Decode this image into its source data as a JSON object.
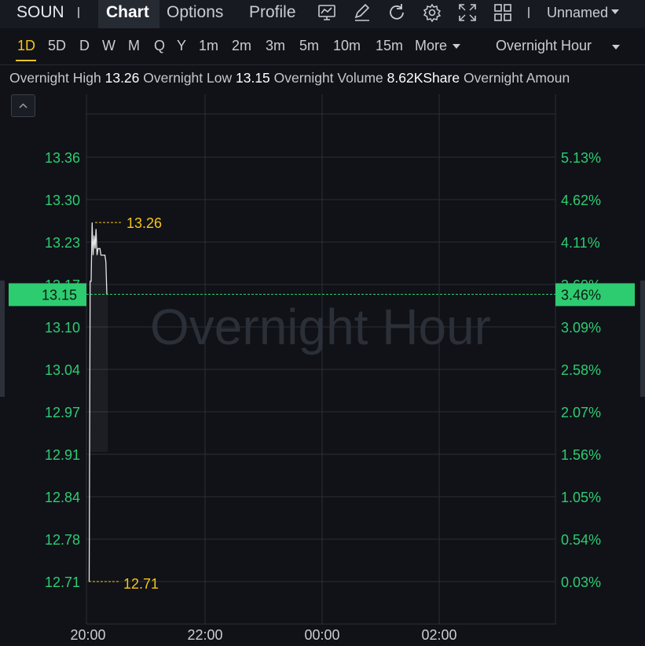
{
  "header": {
    "ticker": "SOUN",
    "tabs": [
      {
        "label": "Chart",
        "active": true
      },
      {
        "label": "Options",
        "active": false
      },
      {
        "label": "Profile",
        "active": false
      }
    ],
    "tool_icons": [
      "chart-settings-icon",
      "draw-icon",
      "refresh-icon",
      "gear-icon",
      "fullscreen-icon",
      "layout-grid-icon"
    ],
    "layout_name": "Unnamed"
  },
  "intervals": {
    "items": [
      "1D",
      "5D",
      "D",
      "W",
      "M",
      "Q",
      "Y",
      "1m",
      "2m",
      "3m",
      "5m",
      "10m",
      "15m"
    ],
    "active": "1D",
    "more_label": "More",
    "session_label": "Overnight Hour"
  },
  "info": {
    "high_label": "Overnight High",
    "high_value": "13.26",
    "low_label": "Overnight Low",
    "low_value": "13.15",
    "volume_label": "Overnight Volume",
    "volume_value": "8.62KShare",
    "amount_label": "Overnight Amoun"
  },
  "colors": {
    "price_axis": "#2ecc71",
    "marker": "#f5c518",
    "current_price_bg": "#2ecc71",
    "line": "#e6e6e6"
  },
  "chart_data": {
    "type": "line",
    "watermark": "Overnight Hour",
    "x_ticks": [
      "20:00",
      "22:00",
      "00:00",
      "02:00"
    ],
    "y_ticks": [
      13.36,
      13.3,
      13.23,
      13.17,
      13.1,
      13.04,
      12.97,
      12.91,
      12.84,
      12.78,
      12.71
    ],
    "y_tick_labels": [
      "13.36",
      "13.30",
      "13.23",
      "13.17",
      "13.10",
      "13.04",
      "12.97",
      "12.91",
      "12.84",
      "12.78",
      "12.71"
    ],
    "pct_tick_labels": [
      "5.13%",
      "4.62%",
      "4.11%",
      "3.60%",
      "3.09%",
      "2.58%",
      "2.07%",
      "1.56%",
      "1.05%",
      "0.54%",
      "0.03%"
    ],
    "ylim": [
      12.71,
      13.36
    ],
    "x_minutes_range": [
      0,
      480
    ],
    "series": [
      {
        "x": [
          0,
          1,
          2,
          3,
          4,
          5,
          6,
          7,
          8,
          9,
          10,
          11,
          12,
          13,
          14,
          15,
          16,
          17,
          18,
          19
        ],
        "y": [
          12.71,
          13.17,
          13.17,
          13.26,
          13.21,
          13.24,
          13.22,
          13.25,
          13.21,
          13.22,
          13.22,
          13.22,
          13.21,
          13.21,
          13.21,
          13.21,
          13.21,
          13.2,
          13.15,
          13.15
        ]
      }
    ],
    "high_marker": {
      "label": "13.26",
      "value": 13.26
    },
    "low_marker": {
      "label": "12.71",
      "value": 12.71
    },
    "current_price": {
      "label": "13.15",
      "value": 13.15,
      "pct_label": "3.46%"
    },
    "grid": true
  }
}
